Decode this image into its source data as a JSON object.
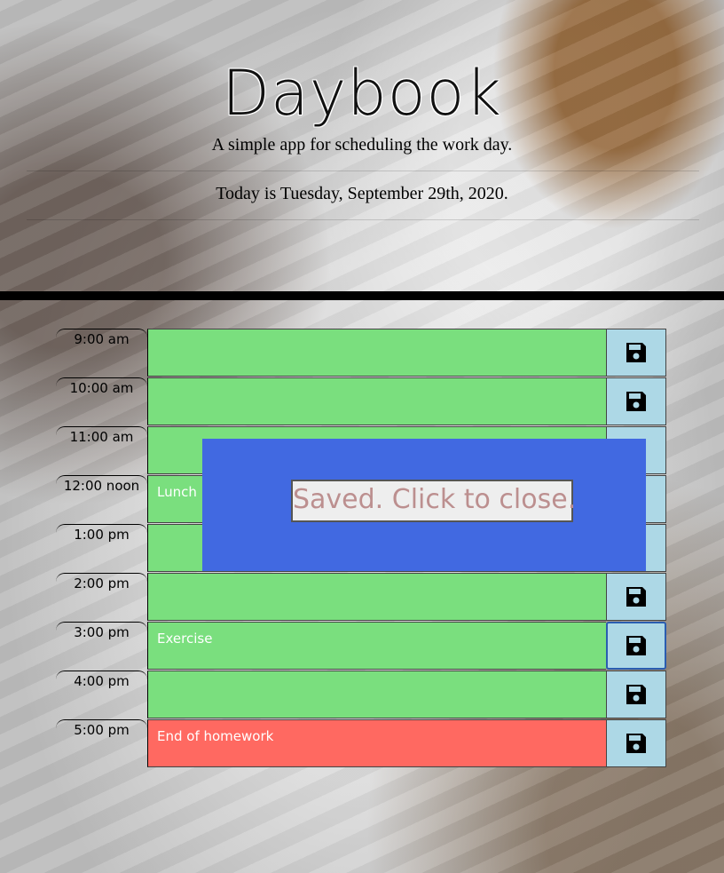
{
  "header": {
    "title": "Daybook",
    "subtitle": "A simple app for scheduling the work day.",
    "today_prefix": "Today is ",
    "today_date": "Tuesday, September 29th, 2020",
    "today_suffix": "."
  },
  "schedule": {
    "hours": [
      {
        "label": "9:00 am",
        "task": "",
        "status": "present"
      },
      {
        "label": "10:00 am",
        "task": "",
        "status": "present"
      },
      {
        "label": "11:00 am",
        "task": "",
        "status": "present"
      },
      {
        "label": "12:00 noon",
        "task": "Lunch",
        "status": "present"
      },
      {
        "label": "1:00 pm",
        "task": "",
        "status": "present"
      },
      {
        "label": "2:00 pm",
        "task": "",
        "status": "present"
      },
      {
        "label": "3:00 pm",
        "task": "Exercise",
        "status": "present"
      },
      {
        "label": "4:00 pm",
        "task": "",
        "status": "present"
      },
      {
        "label": "5:00 pm",
        "task": "End of homework",
        "status": "red"
      }
    ],
    "save_icon": "floppy-disk-icon"
  },
  "modal": {
    "message": "Saved. Click to close."
  },
  "colors": {
    "task_green": "#7adf7e",
    "task_red": "#ff6961",
    "save_bg": "#add8e6",
    "modal_bg": "#4169e1",
    "modal_text": "#bc8f8f"
  }
}
